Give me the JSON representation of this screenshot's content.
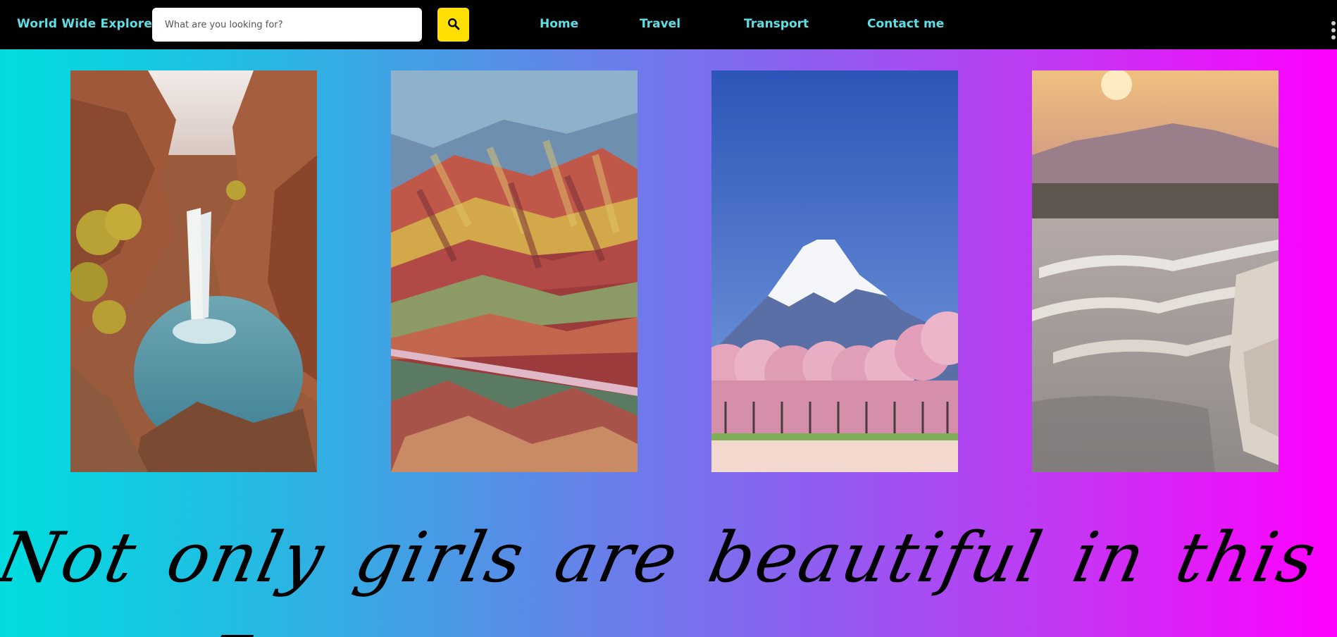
{
  "header": {
    "brand": "World Wide Explorers",
    "search": {
      "placeholder": "What are you looking for?",
      "value": ""
    },
    "search_button_icon": "search-icon",
    "nav": [
      {
        "label": "Home"
      },
      {
        "label": "Travel"
      },
      {
        "label": "Transport"
      },
      {
        "label": "Contact me"
      }
    ],
    "menu_icon": "kebab-menu-icon"
  },
  "gallery": {
    "photos": [
      {
        "name": "waterfall-canyon-photo"
      },
      {
        "name": "rainbow-mountains-photo"
      },
      {
        "name": "snowy-mountain-cherry-blossoms-photo"
      },
      {
        "name": "travertine-terraces-photo"
      }
    ]
  },
  "tagline": "Not only girls are beautiful in this world",
  "colors": {
    "navbar": "#000000",
    "nav_text": "#5ce0e6",
    "search_button": "#ffe000",
    "gradient_start": "#00dde0",
    "gradient_end": "#ff00ff"
  }
}
